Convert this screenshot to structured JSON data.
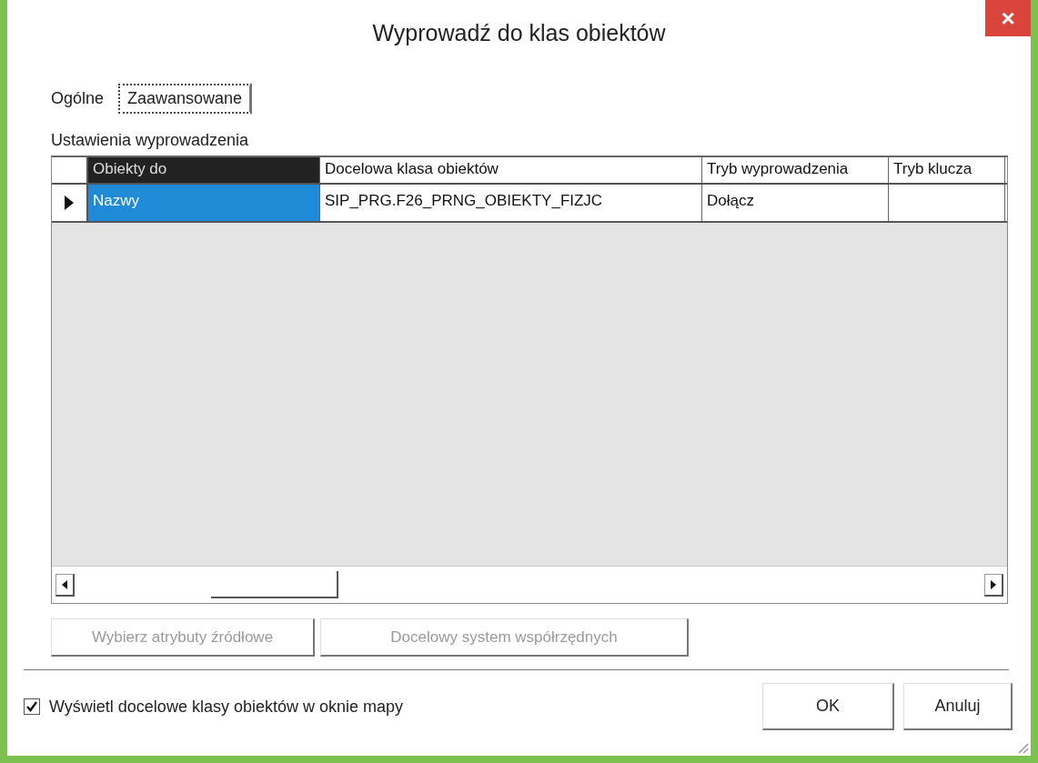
{
  "window": {
    "title": "Wyprowadź do klas obiektów",
    "close": "×"
  },
  "tabs": [
    {
      "label": "Ogólne",
      "selected": false
    },
    {
      "label": "Zaawansowane",
      "selected": true
    }
  ],
  "group_label": "Ustawienia wyprowadzenia",
  "table": {
    "columns": [
      {
        "label": "Obiekty do",
        "selected": true
      },
      {
        "label": "Docelowa klasa obiektów",
        "selected": false
      },
      {
        "label": "Tryb wyprowadzenia",
        "selected": false
      },
      {
        "label": "Tryb klucza",
        "selected": false
      }
    ],
    "rows": [
      {
        "selected": true,
        "cells": [
          "Nazwy",
          "SIP_PRG.F26_PRNG_OBIEKTY_FIZJC",
          "Dołącz",
          ""
        ]
      }
    ]
  },
  "action_buttons": [
    {
      "label": "Wybierz atrybuty źródłowe",
      "disabled": true
    },
    {
      "label": "Docelowy system współrzędnych",
      "disabled": true
    }
  ],
  "checkbox": {
    "label": "Wyświetl docelowe klasy obiektów w oknie mapy",
    "checked": true
  },
  "buttons": [
    "OK",
    "Anuluj"
  ]
}
